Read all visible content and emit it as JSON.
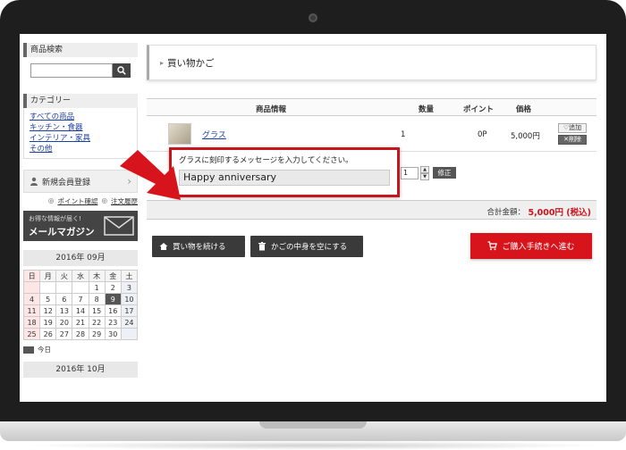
{
  "sidebar": {
    "search_heading": "商品検索",
    "category_heading": "カテゴリー",
    "categories": [
      "すべての商品",
      "キッチン・食器",
      "インテリア・家具",
      "その他"
    ],
    "member_register": "新規会員登録",
    "point_link": "ポイント確認",
    "order_history_link": "注文履歴",
    "mail_banner_small": "お得な情報が届く!",
    "mail_banner_big": "メールマガジン",
    "calendar_title": "2016年 09月",
    "calendar_weekdays": [
      "日",
      "月",
      "火",
      "水",
      "木",
      "金",
      "土"
    ],
    "calendar_weeks": [
      [
        "",
        "",
        "",
        "",
        "1",
        "2",
        "3"
      ],
      [
        "4",
        "5",
        "6",
        "7",
        "8",
        "9",
        "10"
      ],
      [
        "11",
        "12",
        "13",
        "14",
        "15",
        "16",
        "17"
      ],
      [
        "18",
        "19",
        "20",
        "21",
        "22",
        "23",
        "24"
      ],
      [
        "25",
        "26",
        "27",
        "28",
        "29",
        "30",
        ""
      ]
    ],
    "calendar_today": "9",
    "legend_today": "今日",
    "calendar_title_next": "2016年 10月"
  },
  "cart": {
    "title": "買い物かご",
    "col_item": "商品情報",
    "col_qty": "数量",
    "col_point": "ポイント",
    "col_price": "価格",
    "item_name": "グラス",
    "item_qty": "1",
    "item_point": "0P",
    "item_price": "5,000円",
    "add_label": "追加",
    "delete_label": "削除",
    "stepper_value": "1",
    "fix_label": "修正",
    "message_label": "グラスに刻印するメッセージを入力してください。",
    "message_value": "Happy anniversary",
    "total_label": "合計金額：",
    "total_value": "5,000円 (税込)",
    "continue_label": "買い物を続ける",
    "clear_label": "かごの中身を空にする",
    "checkout_label": "ご購入手続きへ進む"
  },
  "colors": {
    "accent_red": "#d7141b",
    "link_blue": "#1a3fa8"
  }
}
